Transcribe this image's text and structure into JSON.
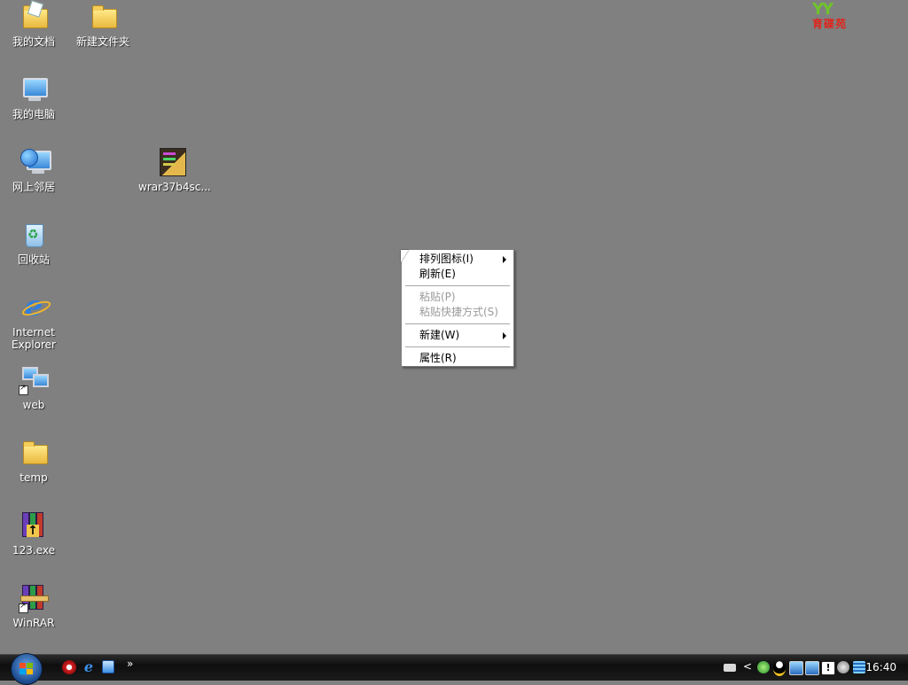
{
  "desktop": {
    "icons": [
      {
        "id": "my-documents",
        "label": "我的文档"
      },
      {
        "id": "new-folder",
        "label": "新建文件夹"
      },
      {
        "id": "my-computer",
        "label": "我的电脑"
      },
      {
        "id": "network-places",
        "label": "网上邻居"
      },
      {
        "id": "winrar-archive",
        "label": "wrar37b4sc..."
      },
      {
        "id": "recycle-bin",
        "label": "回收站"
      },
      {
        "id": "internet-explorer",
        "label": "Internet\nExplorer"
      },
      {
        "id": "web",
        "label": "web"
      },
      {
        "id": "temp",
        "label": "temp"
      },
      {
        "id": "exe-123",
        "label": "123.exe"
      },
      {
        "id": "winrar",
        "label": "WinRAR"
      }
    ]
  },
  "logo": {
    "leaves": "YY",
    "title": "育碟苑"
  },
  "context_menu": {
    "items": [
      {
        "label": "排列图标(I)",
        "submenu": true,
        "disabled": false
      },
      {
        "label": "刷新(E)",
        "submenu": false,
        "disabled": false
      },
      {
        "label": "粘贴(P)",
        "submenu": false,
        "disabled": true
      },
      {
        "label": "粘贴快捷方式(S)",
        "submenu": false,
        "disabled": true
      },
      {
        "label": "新建(W)",
        "submenu": true,
        "disabled": false
      },
      {
        "label": "属性(R)",
        "submenu": false,
        "disabled": false
      }
    ]
  },
  "taskbar": {
    "quicklaunch_more": "»",
    "tray_expand": "<",
    "clock": "16:40"
  },
  "colors": {
    "desktop": "#808080",
    "taskbar": "#0e0e0e",
    "menu_bg": "#ffffff",
    "menu_disabled": "#9a9a9a"
  }
}
